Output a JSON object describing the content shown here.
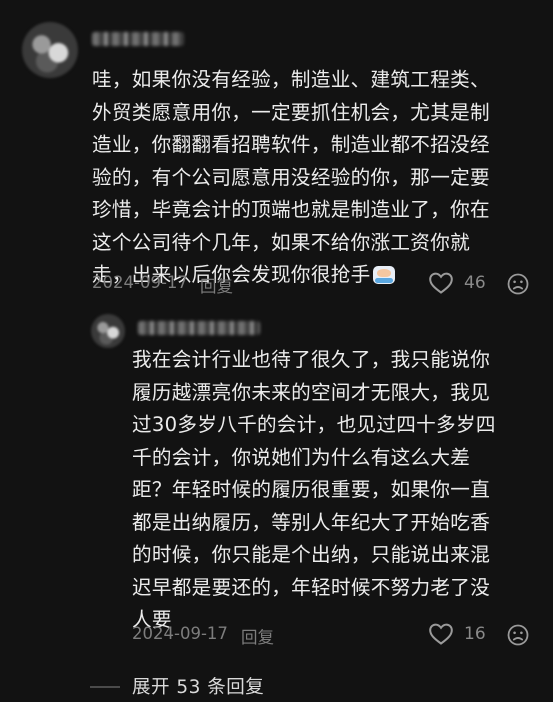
{
  "comment": {
    "text": "哇，如果你没有经验，制造业、建筑工程类、\n外贸类愿意用你，一定要抓住机会，尤其是制\n造业，你翻翻看招聘软件，制造业都不招没经\n验的，有个公司愿意用没经验的你，那一定要\n珍惜，毕竟会计的顶端也就是制造业了，你在\n这个公司待个几年，如果不给你涨工资你就\n走，出来以后你会发现你很抢手",
    "emoji": "grimacing-face",
    "date": "2024-09-17",
    "reply_label": "回复",
    "likes": "46"
  },
  "reply": {
    "text": "我在会计行业也待了很久了，我只能说你\n履历越漂亮你未来的空间才无限大，我见\n过30多岁八千的会计，也见过四十多岁四\n千的会计，你说她们为什么有这么大差\n距？年轻时候的履历很重要，如果你一直\n都是出纳履历，等别人年纪大了开始吃香\n的时候，你只能是个出纳，只能说出来混\n迟早都是要还的，年轻时候不努力老了没\n人要",
    "date": "2024-09-17",
    "reply_label": "回复",
    "likes": "16"
  },
  "expand_label": "展开 53 条回复",
  "icons": {
    "like": "heart-outline-icon",
    "dislike": "unhappy-face-icon"
  },
  "colors": {
    "background": "#121212",
    "text": "#ececec",
    "meta": "#7d7d7d"
  }
}
